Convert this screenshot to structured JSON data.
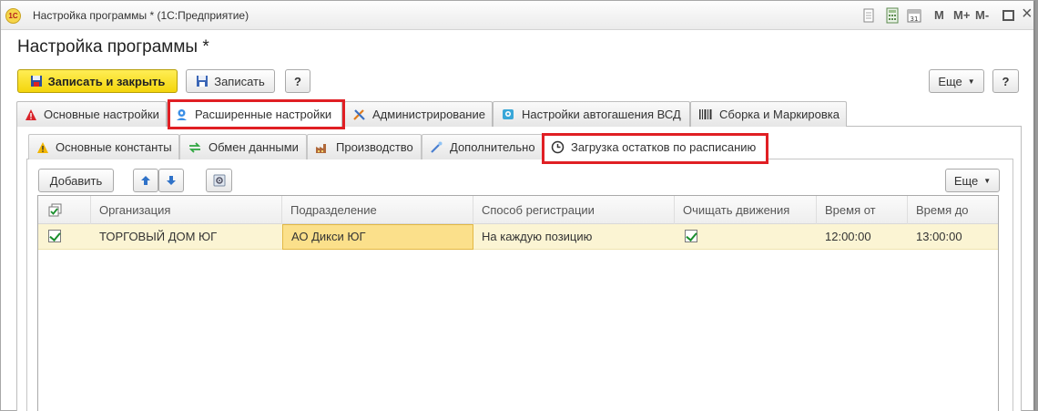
{
  "window": {
    "title": "Настройка программы * (1С:Предприятие)",
    "logo_text": "1С",
    "controls": [
      "M",
      "M+",
      "M-"
    ]
  },
  "form": {
    "title": "Настройка программы *"
  },
  "toolbar": {
    "save_close_label": "Записать и закрыть",
    "save_label": "Записать",
    "help_label": "?",
    "more_label": "Еще",
    "help2_label": "?"
  },
  "main_tabs": [
    {
      "label": "Основные настройки",
      "icon": "warning-red-icon"
    },
    {
      "label": "Расширенные настройки",
      "icon": "settings-person-icon",
      "active": true
    },
    {
      "label": "Администрирование",
      "icon": "tools-icon"
    },
    {
      "label": "Настройки автогашения ВСД",
      "icon": "auto-icon"
    },
    {
      "label": "Сборка и Маркировка",
      "icon": "barcode-icon"
    }
  ],
  "sub_tabs": [
    {
      "label": "Основные константы",
      "icon": "warning-yellow-icon"
    },
    {
      "label": "Обмен данными",
      "icon": "exchange-icon"
    },
    {
      "label": "Производство",
      "icon": "factory-icon"
    },
    {
      "label": "Дополнительно",
      "icon": "wand-icon"
    },
    {
      "label": "Загрузка остатков по расписанию",
      "icon": "clock-icon",
      "active": true
    }
  ],
  "grid_toolbar": {
    "add_label": "Добавить",
    "more_label": "Еще"
  },
  "table": {
    "columns": [
      "Организация",
      "Подразделение",
      "Способ регистрации",
      "Очищать движения",
      "Время от",
      "Время до"
    ],
    "rows": [
      {
        "checked": true,
        "organization": "ТОРГОВЫЙ ДОМ ЮГ",
        "division": "АО Дикси ЮГ",
        "registration": "На каждую позицию",
        "clear_movements": true,
        "time_from": "12:00:00",
        "time_to": "13:00:00"
      }
    ]
  },
  "colors": {
    "primary_button": "#f4d50c",
    "highlight_frame": "#e01f24",
    "selected_row": "#fbf4d3",
    "focused_cell": "#fbe08b"
  }
}
